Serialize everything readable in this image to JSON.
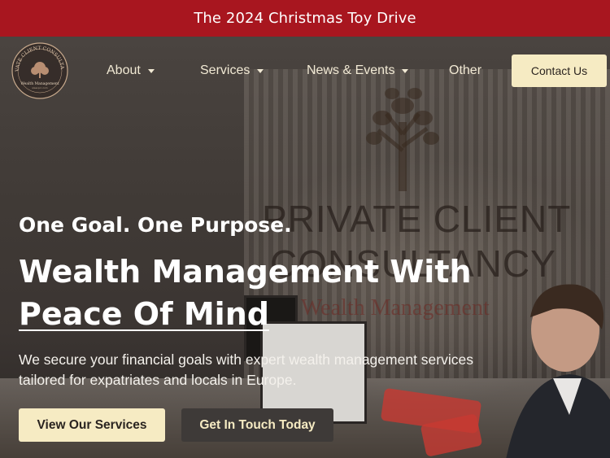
{
  "announcement": {
    "text": "The 2024 Christmas Toy Drive"
  },
  "logo": {
    "arc_text": "PRIVATE CLIENT CONSULTANCY",
    "sub_text": "Wealth Management",
    "small_text": "www.pcc.com"
  },
  "nav": {
    "items": [
      {
        "label": "About",
        "has_dropdown": true
      },
      {
        "label": "Services",
        "has_dropdown": true
      },
      {
        "label": "News & Events",
        "has_dropdown": true
      },
      {
        "label": "Other",
        "has_dropdown": false
      }
    ],
    "contact_label": "Contact Us"
  },
  "background_sign": {
    "line1": "PRIVATE CLIENT",
    "line2": "CONSULTANCY",
    "line3": "Wealth Management"
  },
  "hero": {
    "tagline": "One Goal. One Purpose.",
    "headline_line1": "Wealth Management With",
    "headline_line2": "Peace Of Mind",
    "description": "We secure your financial goals with expert wealth management services tailored for expatriates and locals in Europe.",
    "primary_button": "View Our Services",
    "secondary_button": "Get In Touch Today"
  },
  "colors": {
    "announcement_bg": "#a8161f",
    "accent_cream": "#f6ebc3",
    "secondary_button_bg": "#3e3a38",
    "nav_text": "#f1e9d4"
  }
}
